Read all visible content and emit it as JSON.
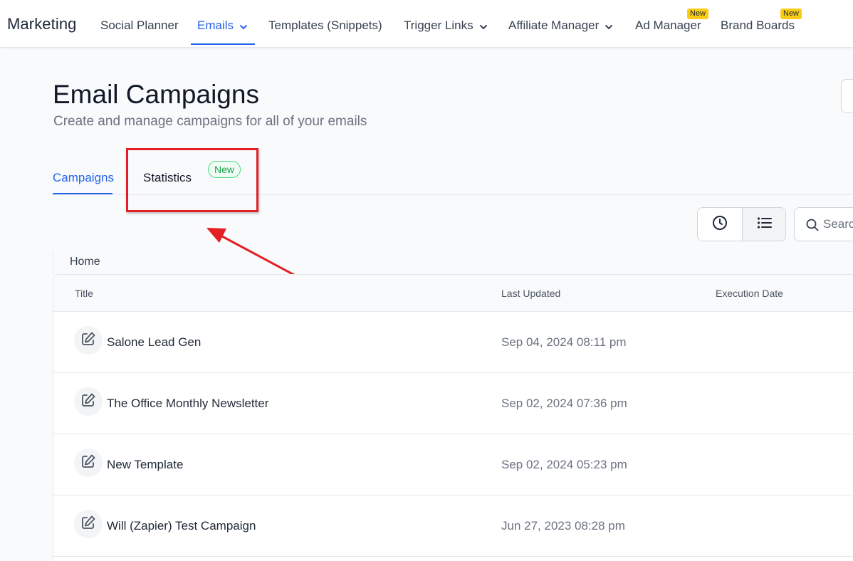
{
  "app": {
    "brand": "Marketing"
  },
  "nav": {
    "items": [
      {
        "label": "Social Planner"
      },
      {
        "label": "Emails"
      },
      {
        "label": "Templates (Snippets)"
      },
      {
        "label": "Trigger Links"
      },
      {
        "label": "Affiliate Manager"
      },
      {
        "label": "Ad Manager",
        "badge": "New"
      },
      {
        "label": "Brand Boards",
        "badge": "New"
      }
    ]
  },
  "page": {
    "title": "Email Campaigns",
    "subtitle": "Create and manage campaigns for all of your emails"
  },
  "tabs": {
    "campaigns": "Campaigns",
    "statistics": "Statistics",
    "statistics_badge": "New"
  },
  "toolbar": {
    "search_placeholder": "Search"
  },
  "breadcrumb": {
    "home": "Home"
  },
  "table": {
    "columns": [
      "Title",
      "Last Updated",
      "Execution Date"
    ],
    "rows": [
      {
        "title": "Salone Lead Gen",
        "last_updated": "Sep 04, 2024 08:11 pm"
      },
      {
        "title": "The Office Monthly Newsletter",
        "last_updated": "Sep 02, 2024 07:36 pm"
      },
      {
        "title": "New Template",
        "last_updated": "Sep 02, 2024 05:23 pm"
      },
      {
        "title": "Will (Zapier) Test Campaign",
        "last_updated": "Jun 27, 2023 08:28 pm"
      }
    ]
  },
  "colors": {
    "accent": "#2563eb",
    "annotation": "#e31e24",
    "new_badge": "#facc15",
    "new_pill": "#16a34a"
  },
  "icons": {
    "clock": "clock-icon",
    "list": "list-icon",
    "search": "search-icon",
    "edit": "edit-icon",
    "chevron": "chevron-down-icon"
  }
}
